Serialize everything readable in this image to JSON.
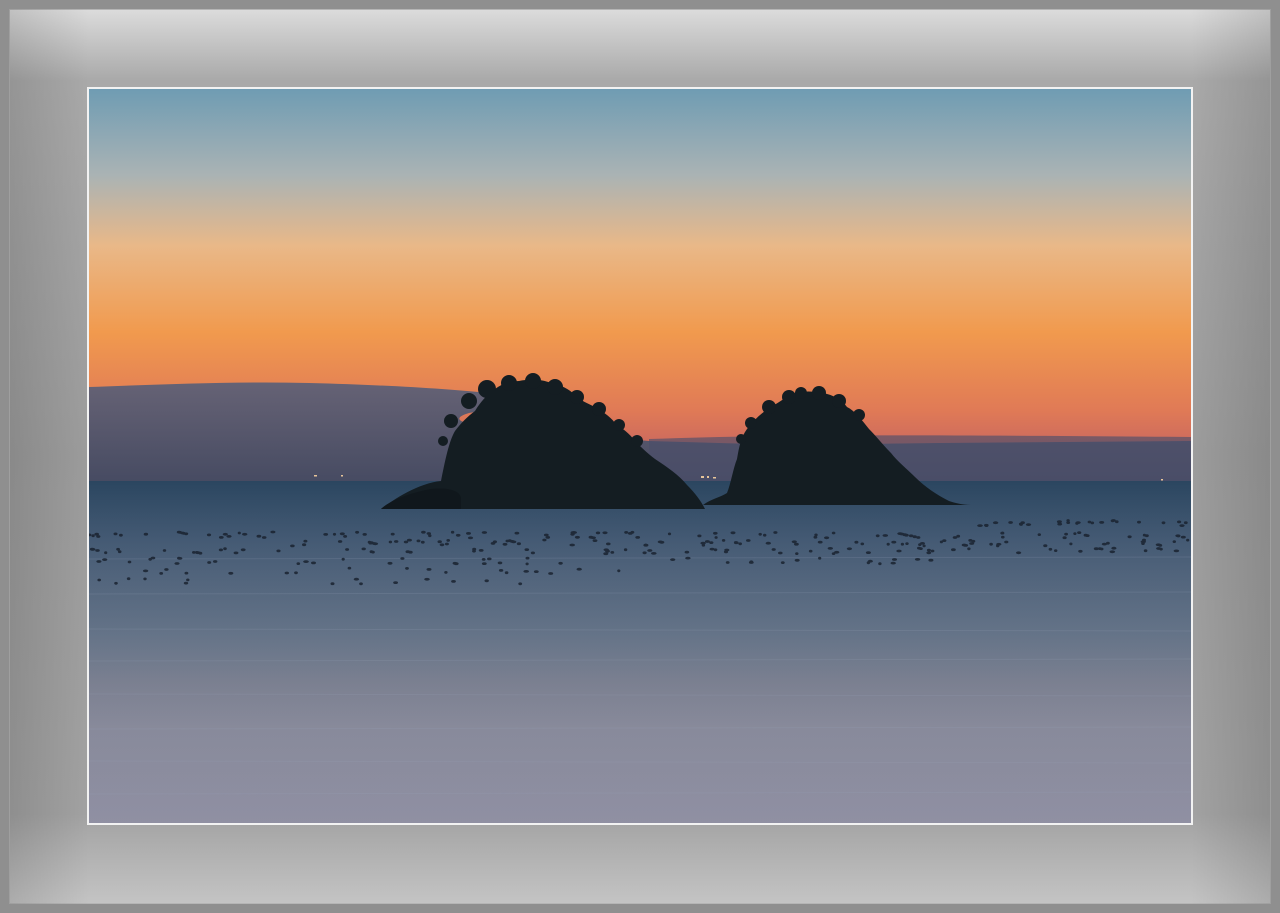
{
  "image": {
    "subject": "sunset-seascape",
    "colors": {
      "sky_top": "#6f9cb3",
      "sky_mid": "#e9b888",
      "sky_glow": "#f19a4e",
      "sky_horizon": "#c95a5a",
      "sea_top": "#2b4660",
      "sea_mid": "#4e6780",
      "sea_bottom": "#8a8fa3",
      "island": "#141d22",
      "frame_outer": "#8f8f8f",
      "frame_mat": "#a6a6a6",
      "photo_border": "#f2f2f2"
    }
  }
}
